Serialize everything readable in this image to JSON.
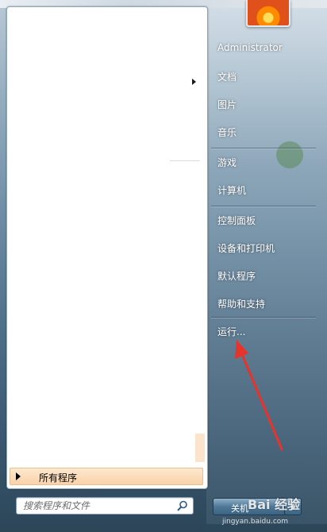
{
  "start_menu": {
    "all_programs_label": "所有程序",
    "search_placeholder": "搜索程序和文件"
  },
  "right_column": {
    "items": [
      {
        "label": "Administrator"
      },
      {
        "label": "文档"
      },
      {
        "label": "图片"
      },
      {
        "label": "音乐"
      },
      {
        "label": "游戏"
      },
      {
        "label": "计算机"
      },
      {
        "label": "控制面板"
      },
      {
        "label": "设备和打印机"
      },
      {
        "label": "默认程序"
      },
      {
        "label": "帮助和支持"
      },
      {
        "label": "运行..."
      }
    ]
  },
  "shutdown": {
    "label": "关机"
  },
  "watermark": {
    "text": "Bai 经验",
    "sub": "jingyan.baidu.com"
  },
  "colors": {
    "annotation_arrow": "#e8332a",
    "all_programs_highlight": "#f9d2a8"
  }
}
